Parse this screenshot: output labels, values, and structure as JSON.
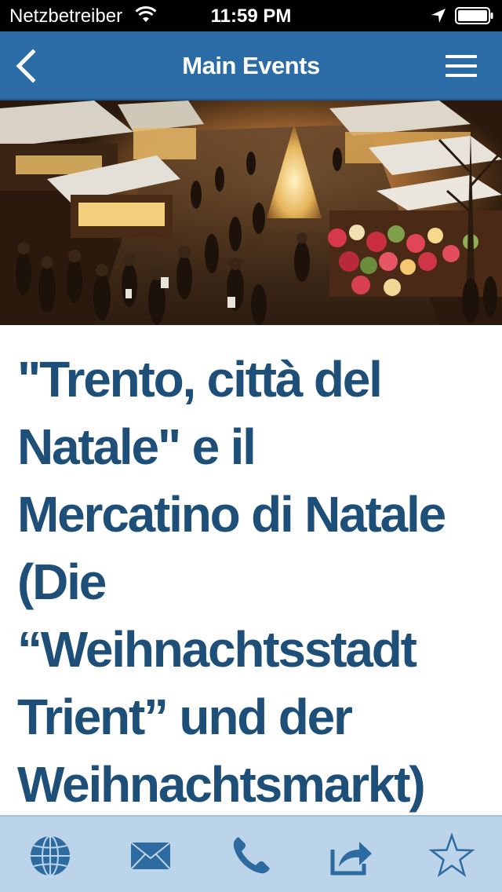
{
  "status_bar": {
    "carrier": "Netzbetreiber",
    "time": "11:59 PM",
    "icons": [
      "wifi-icon",
      "location-arrow-icon",
      "battery-icon"
    ]
  },
  "nav": {
    "title": "Main Events",
    "back_icon": "chevron-left-icon",
    "menu_icon": "hamburger-menu-icon"
  },
  "hero": {
    "description_icon": "christmas-market-photo"
  },
  "article": {
    "title_lines": [
      "\"Trento, città del",
      "Natale\" e il",
      "Mercatino di Natale",
      "(Die",
      "“Weihnachtsstadt",
      "Trient” und der",
      "Weihnachtsmarkt)"
    ]
  },
  "tab_bar": {
    "items": [
      {
        "icon": "globe-icon"
      },
      {
        "icon": "mail-icon"
      },
      {
        "icon": "phone-icon"
      },
      {
        "icon": "share-icon"
      },
      {
        "icon": "star-icon"
      }
    ]
  },
  "colors": {
    "nav_background": "#2b6ca7",
    "title_text": "#1e4f78",
    "tab_bar_background": "#bcd4ea",
    "tab_icon": "#2d6aa0"
  }
}
